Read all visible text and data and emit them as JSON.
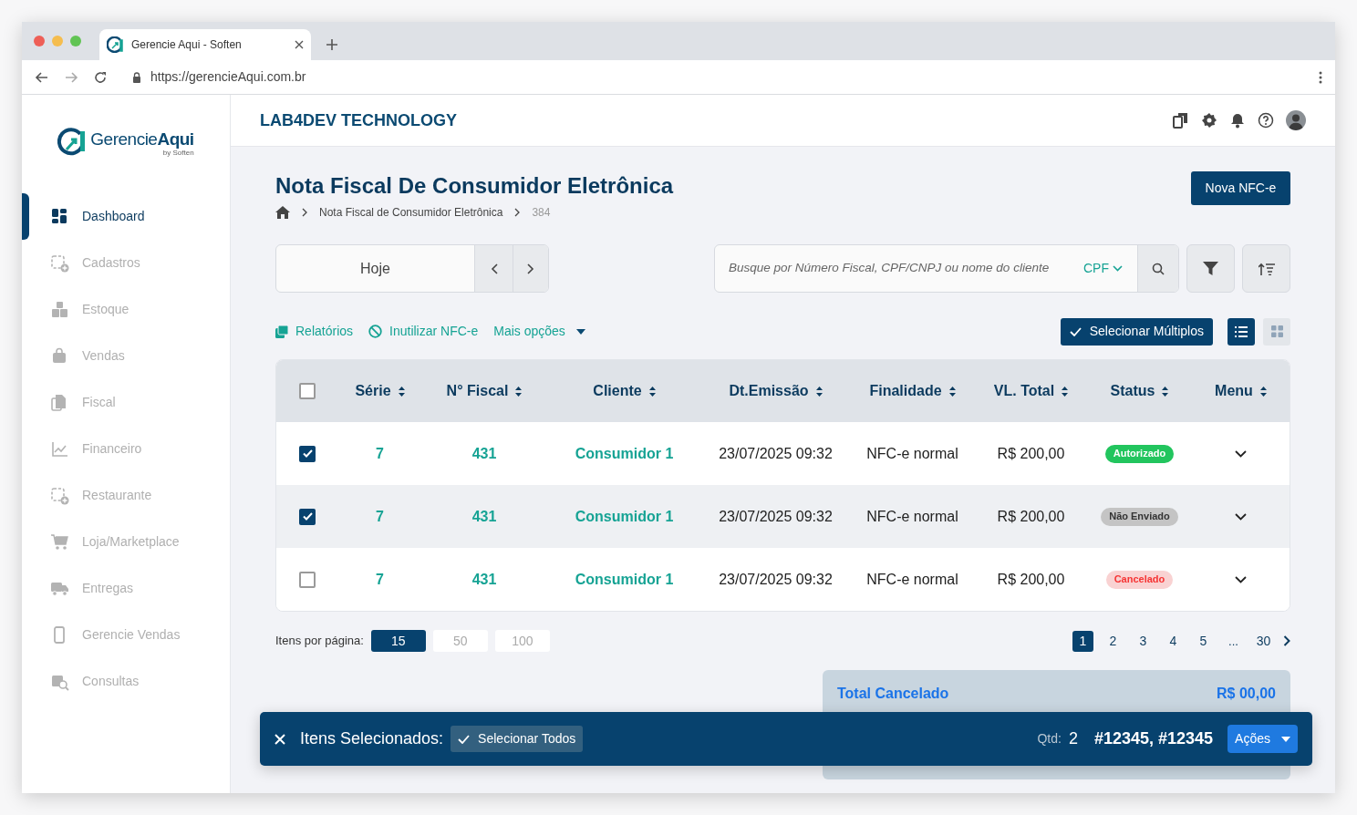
{
  "browser": {
    "tab_title": "Gerencie Aqui - Soften",
    "url": "https://gerencieAqui.com.br"
  },
  "sidebar": {
    "logo": {
      "name": "Gerencie",
      "bold": "Aqui",
      "tagline": "by Soften"
    },
    "items": [
      {
        "label": "Dashboard",
        "selected": true
      },
      {
        "label": "Cadastros",
        "selected": false
      },
      {
        "label": "Estoque",
        "selected": false
      },
      {
        "label": "Vendas",
        "selected": false
      },
      {
        "label": "Fiscal",
        "selected": false
      },
      {
        "label": "Financeiro",
        "selected": false
      },
      {
        "label": "Restaurante",
        "selected": false
      },
      {
        "label": "Loja/Marketplace",
        "selected": false
      },
      {
        "label": "Entregas",
        "selected": false
      },
      {
        "label": "Gerencie Vendas",
        "selected": false
      },
      {
        "label": "Consultas",
        "selected": false
      }
    ]
  },
  "header": {
    "company": "LAB4DEV TECHNOLOGY"
  },
  "page": {
    "title": "Nota Fiscal De Consumidor Eletrônica",
    "new_button": "Nova NFC-e",
    "breadcrumb": [
      "Nota Fiscal de Consumidor Eletrônica",
      "384"
    ]
  },
  "date_filter": {
    "value": "Hoje"
  },
  "search": {
    "placeholder": "Busque por Número Fiscal, CPF/CNPJ ou nome do cliente",
    "doc_type": "CPF"
  },
  "actions": [
    "Relatórios",
    "Inutilizar NFC-e",
    "Mais opções"
  ],
  "select_multiple": "Selecionar Múltiplos",
  "view_modes": [
    {
      "kind": "list",
      "selected": true
    },
    {
      "kind": "grid",
      "selected": false
    }
  ],
  "table": {
    "all_checked": false,
    "columns": [
      "Série",
      "N° Fiscal",
      "Cliente",
      "Dt.Emissão",
      "Finalidade",
      "VL. Total",
      "Status",
      "Menu"
    ],
    "rows": [
      {
        "checked": true,
        "serie": "7",
        "numero": "431",
        "cliente": "Consumidor 1",
        "emissao": "23/07/2025 09:32",
        "finalidade": "NFC-e normal",
        "total": "R$ 200,00",
        "status": "Autorizado",
        "color": "#22c55e"
      },
      {
        "checked": true,
        "serie": "7",
        "numero": "431",
        "cliente": "Consumidor 1",
        "emissao": "23/07/2025 09:32",
        "finalidade": "NFC-e normal",
        "total": "R$ 200,00",
        "status": "Não Enviado",
        "color": "#c4c4c4"
      },
      {
        "checked": false,
        "serie": "7",
        "numero": "431",
        "cliente": "Consumidor 1",
        "emissao": "23/07/2025 09:32",
        "finalidade": "NFC-e normal",
        "total": "R$ 200,00",
        "status": "Cancelado",
        "color": "#f9d2d2"
      }
    ]
  },
  "pagination": {
    "label": "Itens por página:",
    "page_sizes": [
      {
        "label": "15",
        "selected": true
      },
      {
        "label": "50",
        "selected": false
      },
      {
        "label": "100",
        "selected": false
      }
    ],
    "pages": [
      {
        "label": "1",
        "kind": "page",
        "selected": true
      },
      {
        "label": "2",
        "kind": "page",
        "selected": false
      },
      {
        "label": "3",
        "kind": "page",
        "selected": false
      },
      {
        "label": "4",
        "kind": "page",
        "selected": false
      },
      {
        "label": "5",
        "kind": "page",
        "selected": false
      },
      {
        "label": "...",
        "kind": "ellipsis",
        "selected": false
      },
      {
        "label": "30",
        "kind": "page",
        "selected": false
      }
    ]
  },
  "summary": {
    "label": "Total Cancelado",
    "value": "R$ 00,00"
  },
  "selection_bar": {
    "title": "Itens Selecionados:",
    "select_all": "Selecionar Todos",
    "qty_label": "Qtd:",
    "qty": "2",
    "ids": "#12345, #12345",
    "actions": "Ações"
  }
}
